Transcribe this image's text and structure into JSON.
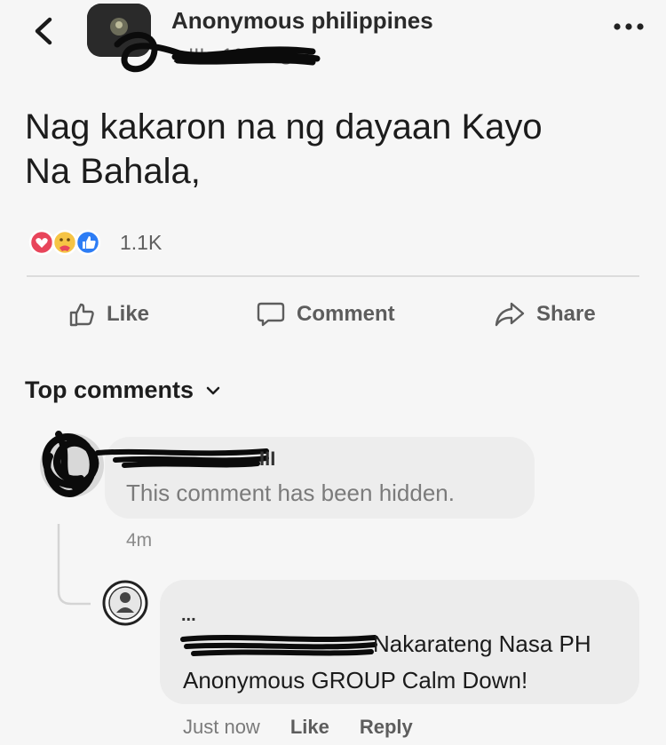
{
  "header": {
    "page_name": "Anonymous philippines",
    "meta": "z III · 16m ·",
    "back_icon": "chevron-left-icon",
    "more_icon": "ellipsis-icon",
    "privacy_icon": "globe-icon"
  },
  "post": {
    "text_line1": "Nag kakaron na ng dayaan Kayo",
    "text_line2": "Na Bahala,",
    "reaction_count": "1.1K",
    "reaction_icons": [
      "love-icon",
      "care-icon",
      "like-icon"
    ]
  },
  "actions": {
    "like": "Like",
    "comment": "Comment",
    "share": "Share"
  },
  "comments": {
    "sort_label": "Top comments",
    "first": {
      "name_fragment": "III",
      "text": "This comment has been hidden.",
      "time": "4m"
    },
    "reply": {
      "name_fragment": "...",
      "line1": "Nakarateng Nasa PH",
      "line2": "Anonymous GROUP Calm Down!",
      "time": "Just now",
      "like": "Like",
      "reply": "Reply"
    }
  },
  "colors": {
    "background": "#f6f6f6",
    "bubble": "#ececec",
    "love": "#e8455b",
    "like_blue": "#2d7df5",
    "care": "#f6c445"
  }
}
